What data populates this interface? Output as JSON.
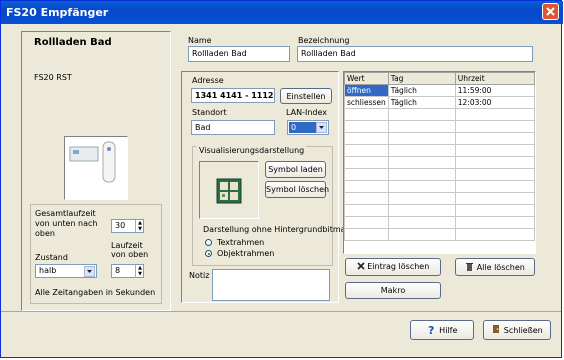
{
  "window": {
    "title": "FS20 Empfänger"
  },
  "device": {
    "name_heading": "Rollladen Bad",
    "model": "FS20 RST"
  },
  "runtime": {
    "total_label": "Gesamtlaufzeit von unten nach oben",
    "total_value": "30",
    "state_label": "Zustand",
    "state_value": "halb",
    "down_label": "Laufzeit von oben",
    "down_value": "8",
    "note": "Alle Zeitangaben in Sekunden"
  },
  "name_field": {
    "label": "Name",
    "value": "Rollladen Bad"
  },
  "desc_field": {
    "label": "Bezeichnung",
    "value": "Rollladen Bad"
  },
  "address": {
    "label": "Adresse",
    "value": "1341 4141 - 1112",
    "button": "Einstellen"
  },
  "location": {
    "label": "Standort",
    "value": "Bad"
  },
  "lan": {
    "label": "LAN-Index",
    "value": "0"
  },
  "visual": {
    "group_label": "Visualisierungsdarstellung",
    "load_button": "Symbol laden",
    "delete_button": "Symbol löschen",
    "bg_label": "Darstellung ohne Hintergrundbitmap",
    "radio1": "Textrahmen",
    "radio2": "Objektrahmen"
  },
  "notes": {
    "label": "Notiz"
  },
  "schedule": {
    "headers": [
      "Wert",
      "Tag",
      "Uhrzeit"
    ],
    "rows": [
      {
        "wert": "öffnen",
        "tag": "Täglich",
        "zeit": "11:59:00"
      },
      {
        "wert": "schliessen",
        "tag": "Täglich",
        "zeit": "12:03:00"
      }
    ]
  },
  "actions": {
    "delete_entry": "Eintrag löschen",
    "delete_all": "Alle löschen",
    "macro": "Makro"
  },
  "footer": {
    "help": "Hilfe",
    "close": "Schließen"
  }
}
